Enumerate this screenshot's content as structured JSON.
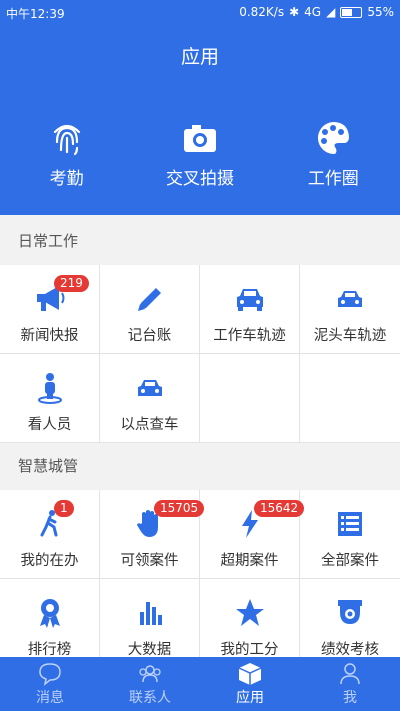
{
  "status": {
    "time": "中午12:39",
    "speed": "0.82K/s",
    "network": "4G",
    "battery": "55%"
  },
  "header": {
    "title": "应用"
  },
  "quick": [
    {
      "label": "考勤",
      "icon": "fingerprint-icon"
    },
    {
      "label": "交叉拍摄",
      "icon": "camera-icon"
    },
    {
      "label": "工作圈",
      "icon": "palette-icon"
    }
  ],
  "sections": [
    {
      "title": "日常工作",
      "items": [
        {
          "label": "新闻快报",
          "icon": "megaphone-icon",
          "badge": "219"
        },
        {
          "label": "记台账",
          "icon": "pencil-icon"
        },
        {
          "label": "工作车轨迹",
          "icon": "car-icon"
        },
        {
          "label": "泥头车轨迹",
          "icon": "car-icon"
        },
        {
          "label": "看人员",
          "icon": "person-location-icon"
        },
        {
          "label": "以点查车",
          "icon": "car-icon"
        }
      ]
    },
    {
      "title": "智慧城管",
      "items": [
        {
          "label": "我的在办",
          "icon": "walking-icon",
          "badge": "1"
        },
        {
          "label": "可领案件",
          "icon": "hand-icon",
          "badge": "15705"
        },
        {
          "label": "超期案件",
          "icon": "lightning-icon",
          "badge": "15642"
        },
        {
          "label": "全部案件",
          "icon": "list-icon"
        },
        {
          "label": "排行榜",
          "icon": "medal-icon"
        },
        {
          "label": "大数据",
          "icon": "bar-chart-icon"
        },
        {
          "label": "我的工分",
          "icon": "star-icon"
        },
        {
          "label": "绩效考核",
          "icon": "camera-dome-icon"
        }
      ]
    }
  ],
  "tabs": [
    {
      "label": "消息",
      "icon": "chat-icon"
    },
    {
      "label": "联系人",
      "icon": "contacts-icon"
    },
    {
      "label": "应用",
      "icon": "box-icon",
      "active": true
    },
    {
      "label": "我",
      "icon": "person-icon"
    }
  ],
  "colors": {
    "primary": "#2f6ee5",
    "badge": "#e53935"
  }
}
